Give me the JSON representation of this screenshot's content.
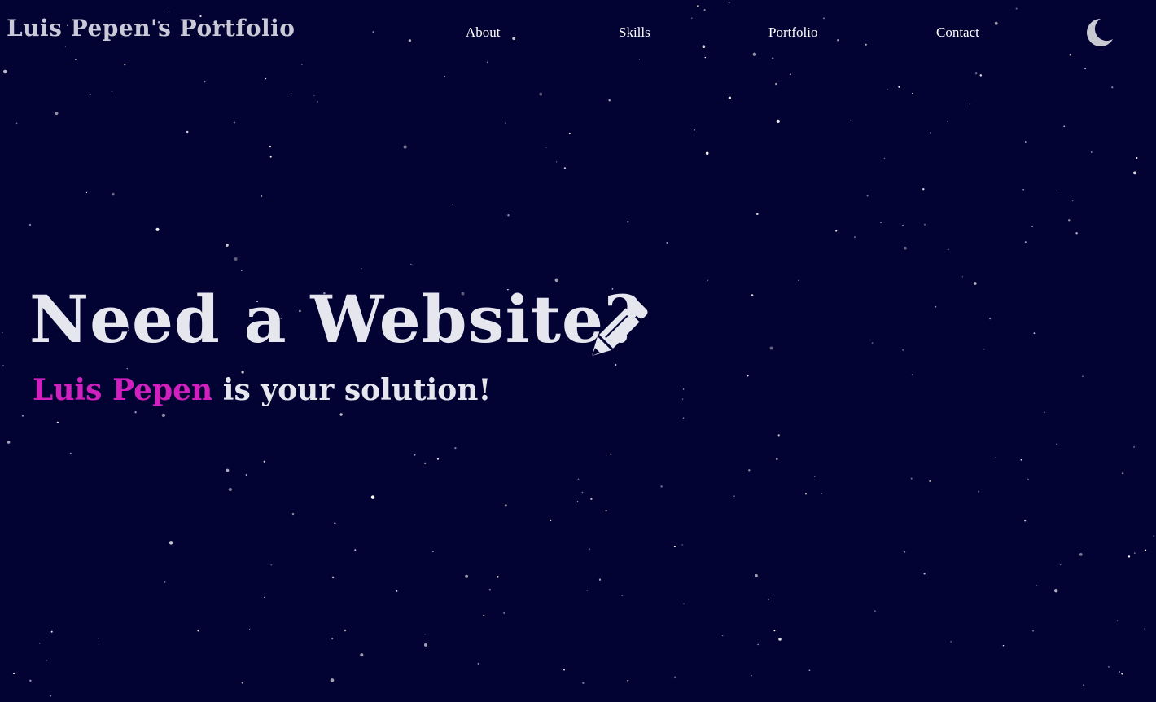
{
  "header": {
    "brand": "Luis Pepen's Portfolio",
    "nav": [
      {
        "label": "About"
      },
      {
        "label": "Skills"
      },
      {
        "label": "Portfolio"
      },
      {
        "label": "Contact"
      }
    ],
    "theme_toggle_icon": "moon-icon"
  },
  "hero": {
    "title": "Need a Website?",
    "title_icon": "pencil-icon",
    "subtitle_name": "Luis Pepen",
    "subtitle_rest": " is your solution!"
  },
  "colors": {
    "background": "#020233",
    "text": "#e6e6ef",
    "accent": "#d21fbf",
    "brand": "#c9c9d8"
  }
}
